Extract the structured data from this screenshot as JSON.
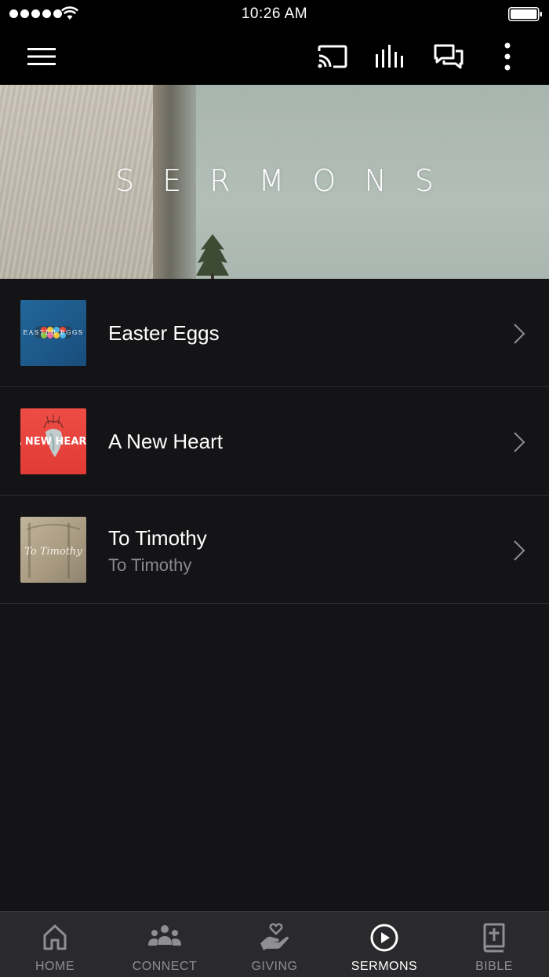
{
  "status_bar": {
    "time": "10:26 AM"
  },
  "top_nav": {
    "icons": [
      "menu-icon",
      "cast-icon",
      "equalizer-icon",
      "chat-icon",
      "more-vertical-icon"
    ]
  },
  "hero": {
    "title": "SERMONS"
  },
  "sermons": [
    {
      "title": "Easter Eggs",
      "subtitle": "",
      "thumb_text": "EASTER EGGS",
      "thumb_color": "#1e6b9c"
    },
    {
      "title": "A New Heart",
      "subtitle": "",
      "thumb_text": "A NEW HEART",
      "thumb_color": "#e8443f"
    },
    {
      "title": "To Timothy",
      "subtitle": "To Timothy",
      "thumb_text": "To Timothy",
      "thumb_color": "#b8ab92"
    }
  ],
  "tabs": [
    {
      "label": "HOME",
      "icon": "home-icon",
      "active": false
    },
    {
      "label": "CONNECT",
      "icon": "people-icon",
      "active": false
    },
    {
      "label": "GIVING",
      "icon": "giving-hand-icon",
      "active": false
    },
    {
      "label": "SERMONS",
      "icon": "play-circle-icon",
      "active": true
    },
    {
      "label": "BIBLE",
      "icon": "bible-icon",
      "active": false
    }
  ],
  "colors": {
    "background": "#141416",
    "tab_bar": "#2a2a2d",
    "active_tab": "#ffffff",
    "inactive_tab": "#8e8e93"
  }
}
